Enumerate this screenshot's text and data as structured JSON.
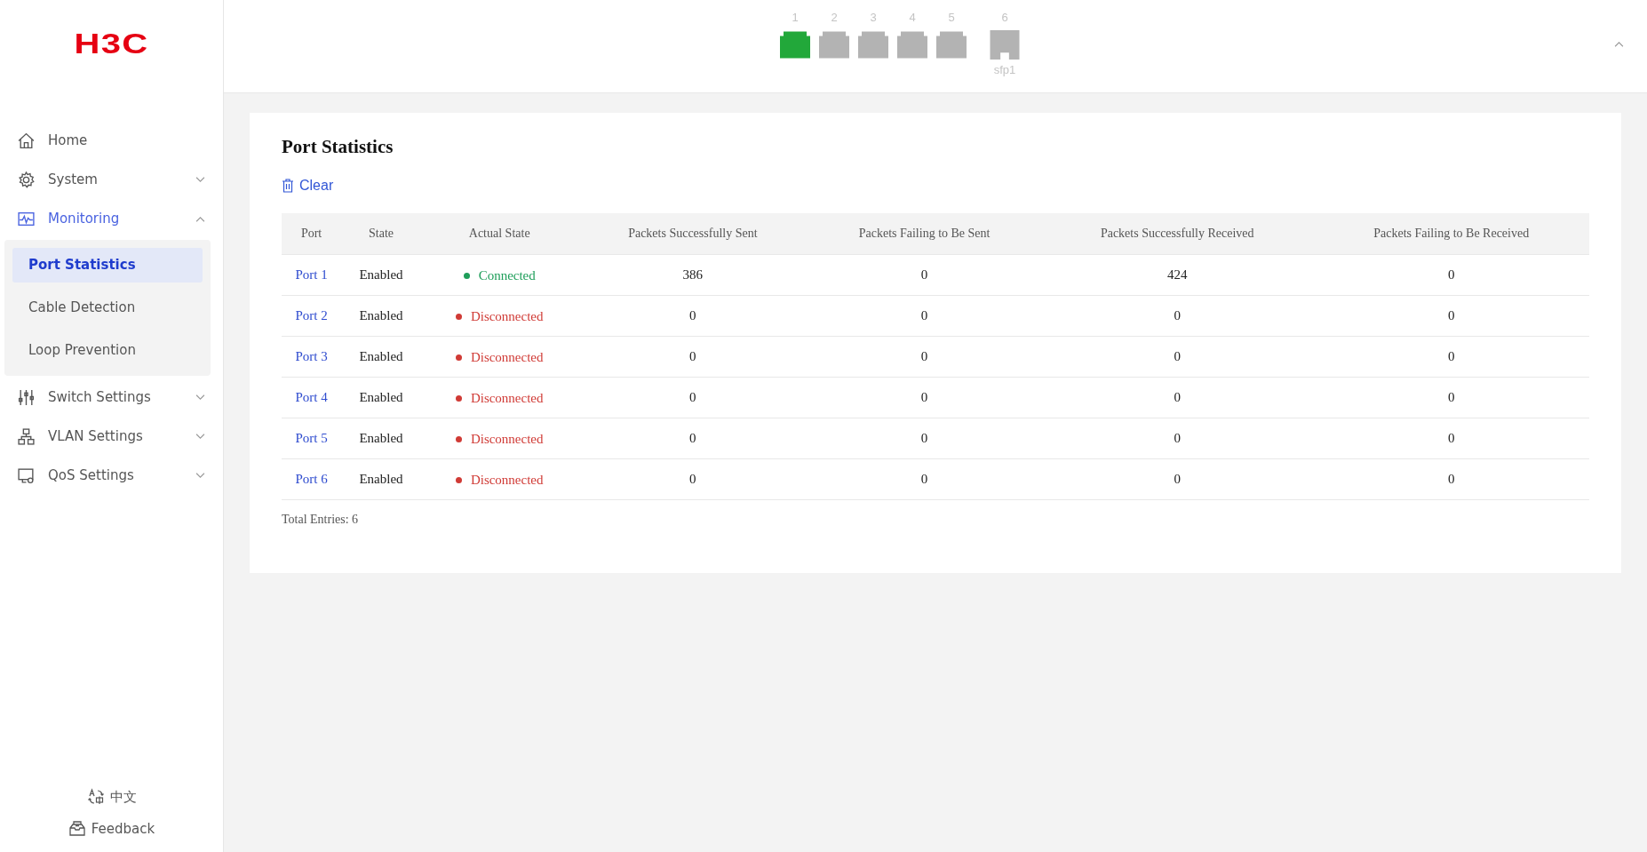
{
  "logo": "H3C",
  "sidebar": {
    "items": [
      {
        "label": "Home",
        "expandable": false,
        "selected": false
      },
      {
        "label": "System",
        "expandable": true,
        "expanded": false,
        "selected": false
      },
      {
        "label": "Monitoring",
        "expandable": true,
        "expanded": true,
        "selected": true,
        "children": [
          {
            "label": "Port Statistics",
            "selected": true
          },
          {
            "label": "Cable Detection",
            "selected": false
          },
          {
            "label": "Loop Prevention",
            "selected": false
          }
        ]
      },
      {
        "label": "Switch Settings",
        "expandable": true,
        "expanded": false,
        "selected": false
      },
      {
        "label": "VLAN Settings",
        "expandable": true,
        "expanded": false,
        "selected": false
      },
      {
        "label": "QoS Settings",
        "expandable": true,
        "expanded": false,
        "selected": false
      }
    ],
    "language": "中文",
    "feedback": "Feedback"
  },
  "ports": [
    {
      "number": "1",
      "kind": "rj45",
      "up": true
    },
    {
      "number": "2",
      "kind": "rj45",
      "up": false
    },
    {
      "number": "3",
      "kind": "rj45",
      "up": false
    },
    {
      "number": "4",
      "kind": "rj45",
      "up": false
    },
    {
      "number": "5",
      "kind": "rj45",
      "up": false
    },
    {
      "number": "6",
      "kind": "sfp",
      "up": false,
      "label": "sfp1"
    }
  ],
  "page": {
    "title": "Port Statistics",
    "clear": "Clear",
    "table": {
      "columns": [
        "Port",
        "State",
        "Actual State",
        "Packets Successfully Sent",
        "Packets Failing to Be Sent",
        "Packets Successfully Received",
        "Packets Failing to Be Received"
      ],
      "rows": [
        {
          "port": "Port 1",
          "state": "Enabled",
          "actual": "Connected",
          "connected": true,
          "sent": "386",
          "sent_fail": "0",
          "received": "424",
          "received_fail": "0"
        },
        {
          "port": "Port 2",
          "state": "Enabled",
          "actual": "Disconnected",
          "connected": false,
          "sent": "0",
          "sent_fail": "0",
          "received": "0",
          "received_fail": "0"
        },
        {
          "port": "Port 3",
          "state": "Enabled",
          "actual": "Disconnected",
          "connected": false,
          "sent": "0",
          "sent_fail": "0",
          "received": "0",
          "received_fail": "0"
        },
        {
          "port": "Port 4",
          "state": "Enabled",
          "actual": "Disconnected",
          "connected": false,
          "sent": "0",
          "sent_fail": "0",
          "received": "0",
          "received_fail": "0"
        },
        {
          "port": "Port 5",
          "state": "Enabled",
          "actual": "Disconnected",
          "connected": false,
          "sent": "0",
          "sent_fail": "0",
          "received": "0",
          "received_fail": "0"
        },
        {
          "port": "Port 6",
          "state": "Enabled",
          "actual": "Disconnected",
          "connected": false,
          "sent": "0",
          "sent_fail": "0",
          "received": "0",
          "received_fail": "0"
        }
      ]
    },
    "total": "Total Entries: 6"
  }
}
